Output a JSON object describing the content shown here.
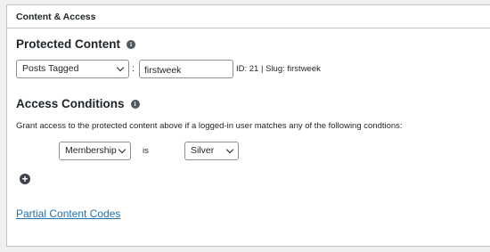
{
  "panel": {
    "title": "Content & Access"
  },
  "protected_content": {
    "title": "Protected Content",
    "info_icon": "info-icon",
    "type_select": {
      "value": "Posts Tagged",
      "options": [
        "Posts Tagged"
      ]
    },
    "separator": ":",
    "tag_input": {
      "value": "firstweek"
    },
    "meta": "ID: 21 | Slug: firstweek"
  },
  "access_conditions": {
    "title": "Access Conditions",
    "info_icon": "info-icon",
    "description": "Grant access to the protected content above if a logged-in user matches any of the following condtions:",
    "rule": {
      "field_select": {
        "value": "Membership"
      },
      "operator": "is",
      "value_select": {
        "value": "Silver"
      }
    },
    "add_icon": "plus-circle-icon"
  },
  "partial_content": {
    "link": "Partial Content Codes"
  }
}
